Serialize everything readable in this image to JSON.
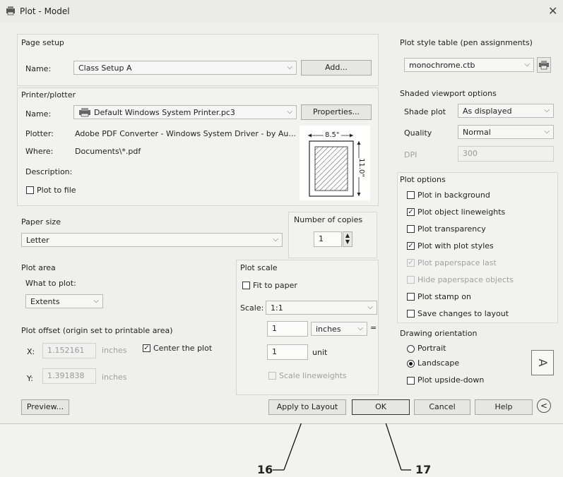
{
  "window": {
    "title": "Plot - Model"
  },
  "page_setup": {
    "label": "Page setup",
    "name_label": "Name:",
    "name_value": "Class Setup A",
    "add_label": "Add..."
  },
  "printer": {
    "label": "Printer/plotter",
    "name_label": "Name:",
    "name_value": "Default Windows System Printer.pc3",
    "properties_label": "Properties...",
    "plotter_label": "Plotter:",
    "plotter_value": "Adobe PDF Converter - Windows System Driver - by Au...",
    "where_label": "Where:",
    "where_value": "Documents\\*.pdf",
    "description_label": "Description:",
    "plot_to_file": "Plot to file",
    "preview_width": "8.5\"",
    "preview_height": "11.0\""
  },
  "paper": {
    "label": "Paper size",
    "value": "Letter",
    "copies_label": "Number of copies",
    "copies_value": "1"
  },
  "plot_area": {
    "label": "Plot area",
    "what_label": "What to plot:",
    "what_value": "Extents"
  },
  "plot_offset": {
    "label": "Plot offset (origin set to printable area)",
    "x_label": "X:",
    "x_value": "1.152161",
    "y_label": "Y:",
    "y_value": "1.391838",
    "units": "inches",
    "center_label": "Center the plot"
  },
  "plot_scale": {
    "label": "Plot scale",
    "fit_label": "Fit to paper",
    "scale_label": "Scale:",
    "scale_value": "1:1",
    "num_value": "1",
    "units_value": "inches",
    "equals": "=",
    "den_value": "1",
    "den_unit": "unit",
    "lineweights_label": "Scale lineweights"
  },
  "style_table": {
    "label": "Plot style table (pen assignments)",
    "value": "monochrome.ctb"
  },
  "shaded": {
    "label": "Shaded viewport options",
    "shade_label": "Shade plot",
    "shade_value": "As displayed",
    "quality_label": "Quality",
    "quality_value": "Normal",
    "dpi_label": "DPI",
    "dpi_value": "300"
  },
  "options": {
    "label": "Plot options",
    "items": [
      {
        "label": "Plot in background",
        "checked": false,
        "enabled": true
      },
      {
        "label": "Plot object lineweights",
        "checked": true,
        "enabled": true
      },
      {
        "label": "Plot transparency",
        "checked": false,
        "enabled": true
      },
      {
        "label": "Plot with plot styles",
        "checked": true,
        "enabled": true
      },
      {
        "label": "Plot paperspace last",
        "checked": true,
        "enabled": false
      },
      {
        "label": "Hide paperspace objects",
        "checked": false,
        "enabled": false
      },
      {
        "label": "Plot stamp on",
        "checked": false,
        "enabled": true
      },
      {
        "label": "Save changes to layout",
        "checked": false,
        "enabled": true
      }
    ]
  },
  "orientation": {
    "label": "Drawing orientation",
    "portrait": "Portrait",
    "landscape": "Landscape",
    "upside_down": "Plot upside-down"
  },
  "footer": {
    "preview": "Preview...",
    "apply": "Apply to Layout",
    "ok": "OK",
    "cancel": "Cancel",
    "help": "Help"
  },
  "annotations": {
    "a16": "16",
    "a17": "17"
  }
}
